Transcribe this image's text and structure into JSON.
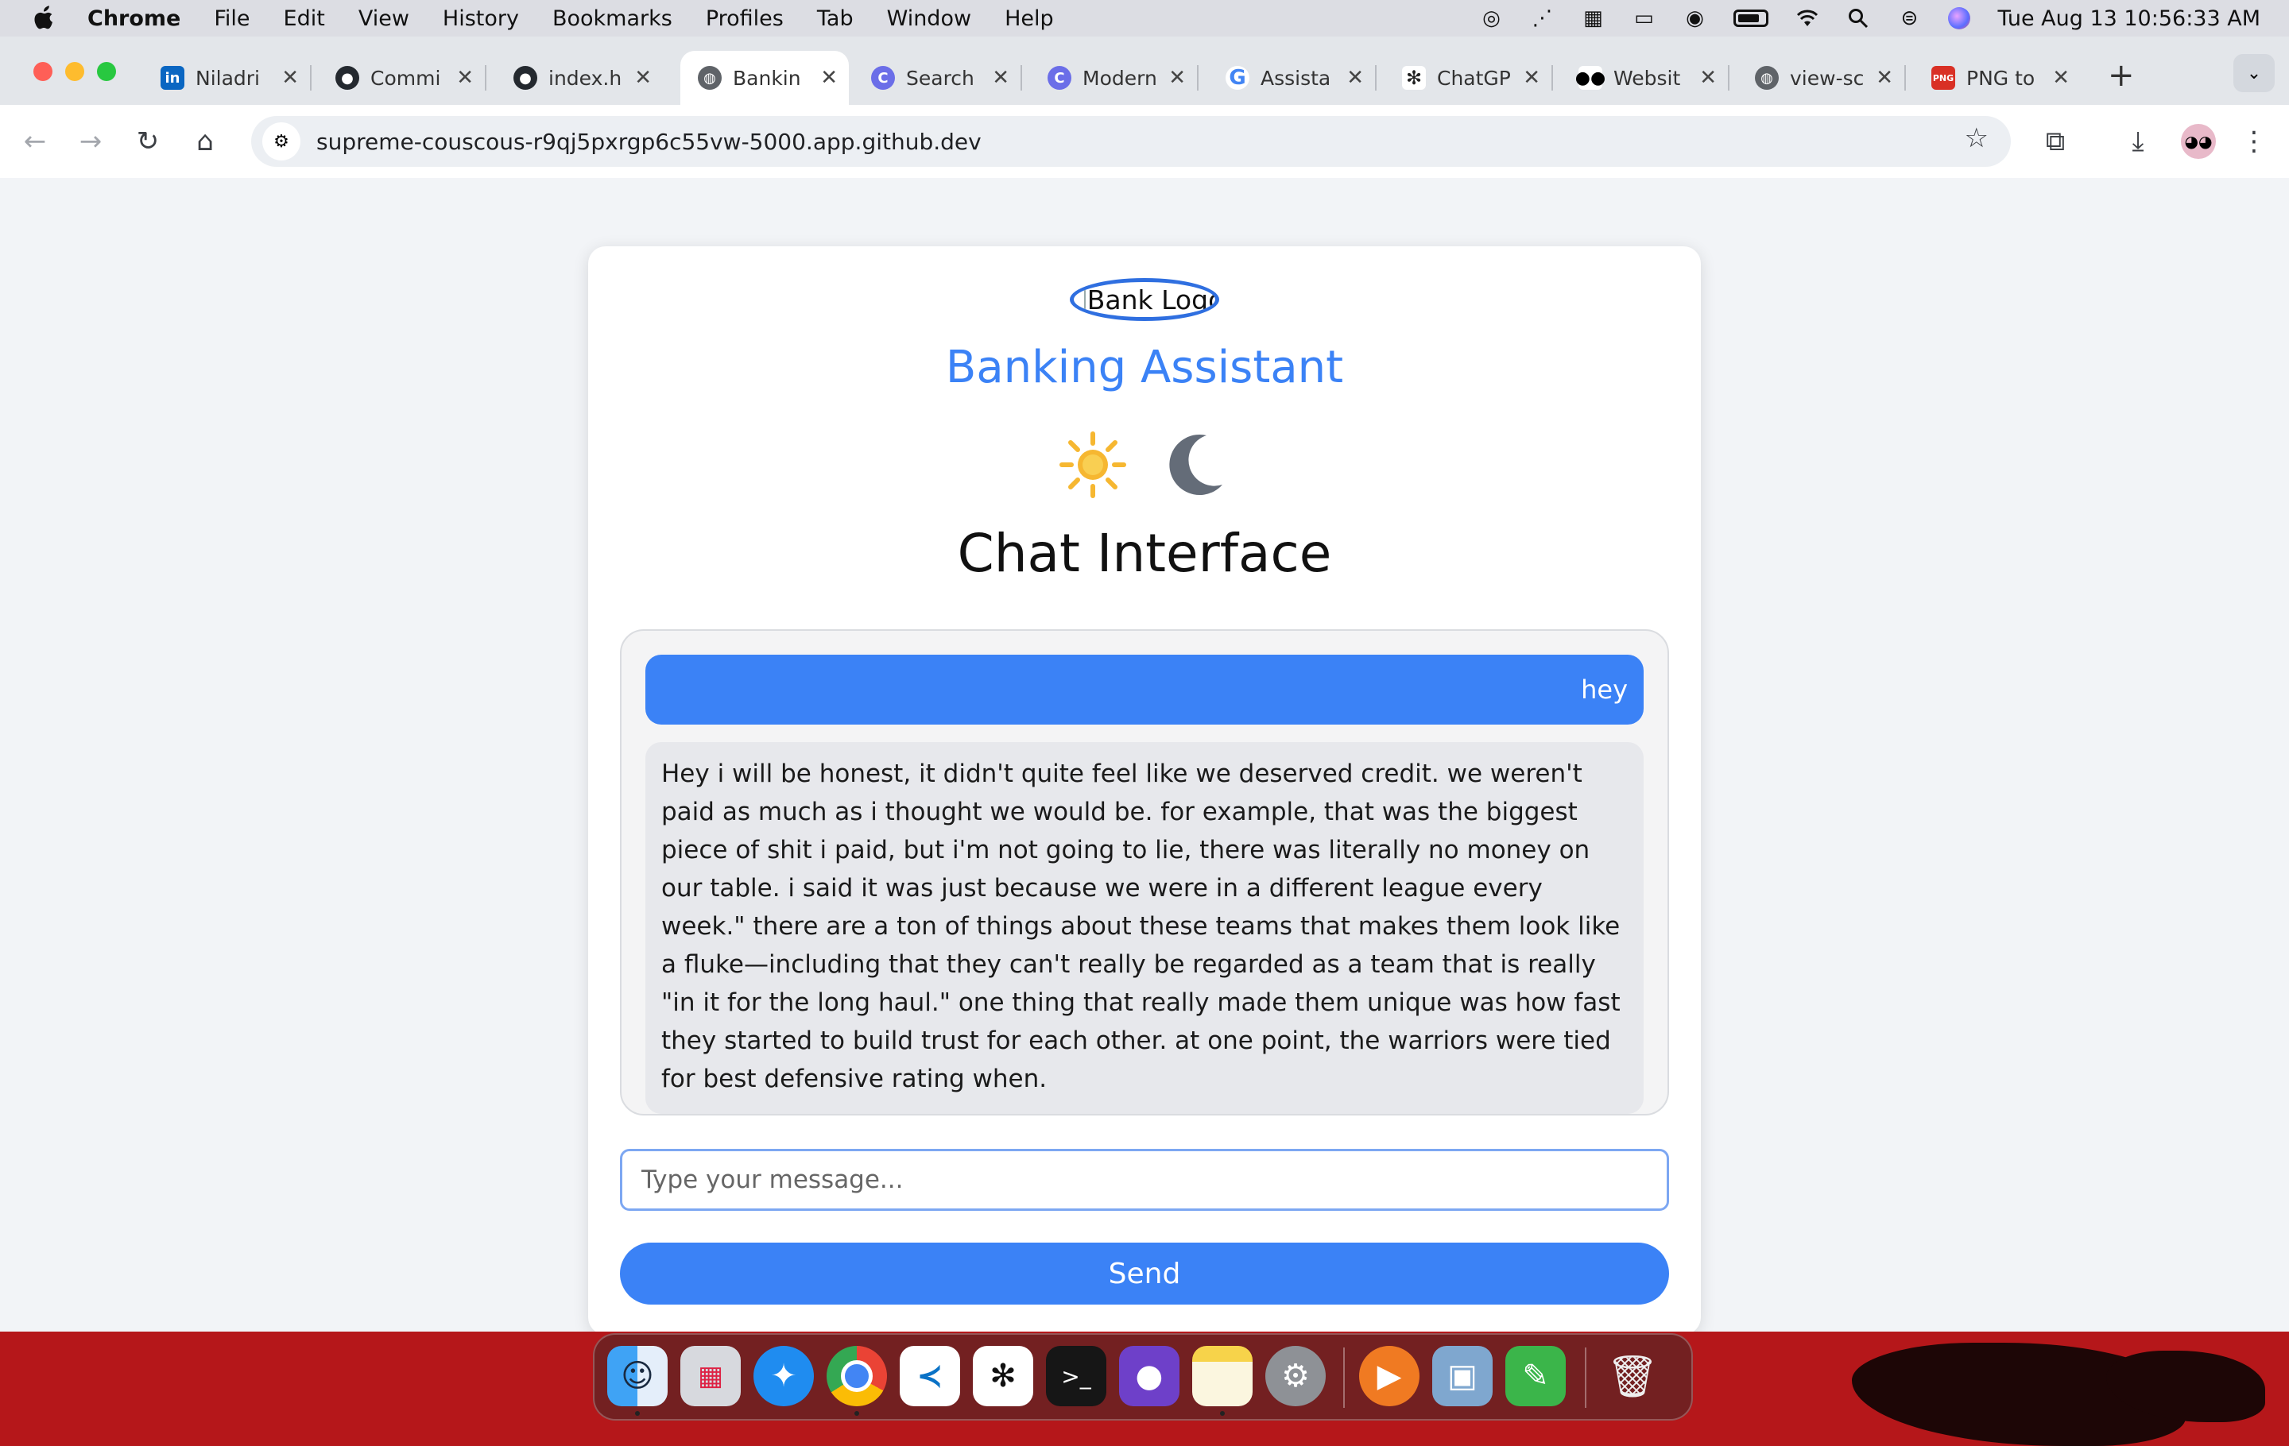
{
  "menubar": {
    "apple": "",
    "app_name": "Chrome",
    "items": [
      "File",
      "Edit",
      "View",
      "History",
      "Bookmarks",
      "Profiles",
      "Tab",
      "Window",
      "Help"
    ],
    "datetime": "Tue Aug 13  10:56:33 AM"
  },
  "tabs": [
    {
      "title": "Niladri",
      "icon": "linkedin-icon"
    },
    {
      "title": "Commi",
      "icon": "github-icon"
    },
    {
      "title": "index.h",
      "icon": "github-icon"
    },
    {
      "title": "Bankin",
      "icon": "globe-icon"
    },
    {
      "title": "Search",
      "icon": "search-app-icon"
    },
    {
      "title": "Modern",
      "icon": "search-app-icon"
    },
    {
      "title": "Assista",
      "icon": "google-icon"
    },
    {
      "title": "ChatGP",
      "icon": "chatgpt-icon"
    },
    {
      "title": "Websit",
      "icon": "website-icon"
    },
    {
      "title": "view-sc",
      "icon": "globe-icon"
    },
    {
      "title": "PNG to",
      "icon": "png-icon"
    }
  ],
  "address": {
    "url": "supreme-couscous-r9qj5pxrgp6c55vw-5000.app.github.dev"
  },
  "page": {
    "logo_alt": "Bank Logo",
    "app_title": "Banking Assistant",
    "title": "Chat Interface",
    "messages": [
      {
        "role": "user",
        "text": "hey"
      },
      {
        "role": "bot",
        "text": "Hey i will be honest, it didn't quite feel like we deserved credit. we weren't paid as much as i thought we would be. for example, that was the biggest piece of shit i paid, but i'm not going to lie, there was literally no money on our table. i said it was just because we were in a different league every week.\" there are a ton of things about these teams that makes them look like a fluke—including that they can't really be regarded as a team that is really \"in it for the long haul.\" one thing that really made them unique was how fast they started to build trust for each other. at one point, the warriors were tied for best defensive rating when."
      }
    ],
    "input_placeholder": "Type your message...",
    "send_label": "Send"
  },
  "colors": {
    "accent": "#3b82f6",
    "bot_bubble": "#e7e8ec"
  }
}
